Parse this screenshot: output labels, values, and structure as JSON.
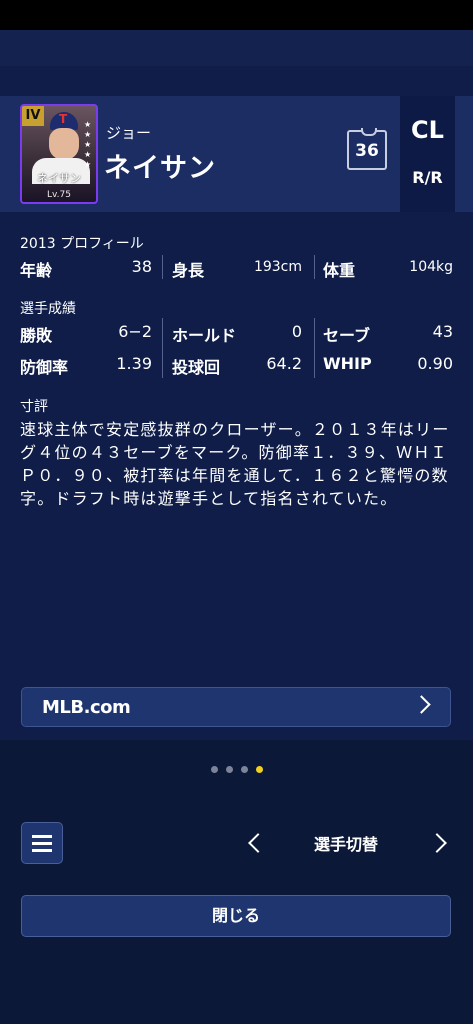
{
  "player": {
    "first_name": "ジョー",
    "last_name": "ネイサン",
    "number": "36",
    "position": "CL",
    "handedness": "R/R",
    "card": {
      "rank": "IV",
      "name": "ネイサン",
      "level": "Lv.75",
      "stars": 5,
      "team_cap_letter": "T"
    }
  },
  "profile": {
    "title": "2013 プロフィール",
    "age_label": "年齢",
    "age_value": "38",
    "height_label": "身長",
    "height_value": "193cm",
    "weight_label": "体重",
    "weight_value": "104kg"
  },
  "stats": {
    "title": "選手成績",
    "record_label": "勝敗",
    "record_value": "6−2",
    "holds_label": "ホールド",
    "holds_value": "0",
    "saves_label": "セーブ",
    "saves_value": "43",
    "era_label": "防御率",
    "era_value": "1.39",
    "ip_label": "投球回",
    "ip_value": "64.2",
    "whip_label": "WHIP",
    "whip_value": "0.90"
  },
  "commentary": {
    "title": "寸評",
    "text": "速球主体で安定感抜群のクローザー。２０１３年はリーグ４位の４３セーブをマーク。防御率１．３９、ＷＨＩＰ０．９０、被打率は年間を通して．１６２と驚愕の数字。ドラフト時は遊撃手として指名されていた。"
  },
  "links": {
    "mlb_label": "MLB.com"
  },
  "pager": {
    "total": 4,
    "active_index": 3
  },
  "nav": {
    "switch_label": "選手切替",
    "close_label": "閉じる"
  },
  "colors": {
    "background": "#0f1d48",
    "header": "#1b2d62",
    "button": "#1f3570",
    "pager_active": "#f2d022",
    "card_frame": "#7b3cf0"
  }
}
